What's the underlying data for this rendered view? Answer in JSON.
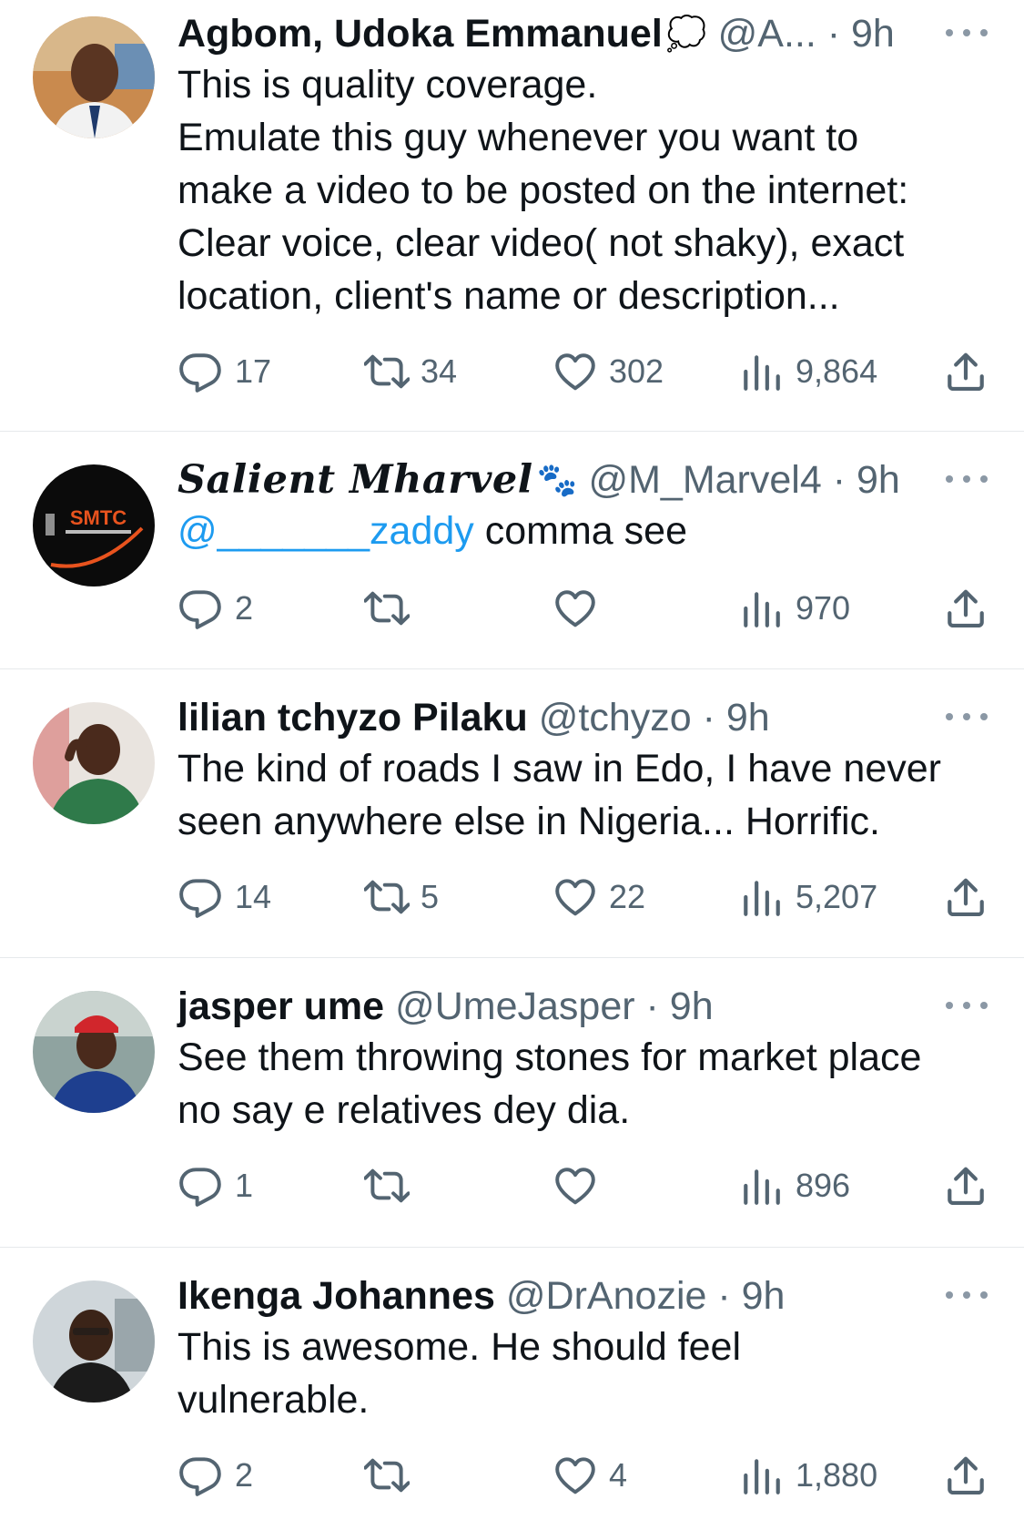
{
  "colors": {
    "text": "#0f1419",
    "secondary": "#536471",
    "link": "#1d9bf0",
    "divider": "#e6e9ec"
  },
  "icons": {
    "reply": "speech-bubble-icon",
    "retweet": "retweet-arrows-icon",
    "like": "heart-icon",
    "views": "bar-chart-icon",
    "share": "share-upload-icon",
    "more": "three-dots-icon"
  },
  "tweets": [
    {
      "name": "Agbom, Udoka Emmanuel",
      "name_emoji": "💭",
      "handle": "@A... · 9h",
      "lines": [
        "This is quality coverage.",
        "Emulate this guy whenever you want to",
        "make a video to be posted on the internet:",
        "Clear voice, clear video( not shaky), exact",
        "location, client's name or description..."
      ],
      "replies": "17",
      "retweets": "34",
      "likes": "302",
      "views": "9,864"
    },
    {
      "name": "Salient Mharvel",
      "name_emoji": "🐾",
      "handle": "@M_Marvel4 · 9h",
      "mention": "@_______zaddy",
      "text_after_mention": " comma see",
      "avatar_text": "SMTC",
      "replies": "2",
      "retweets": "",
      "likes": "",
      "views": "970"
    },
    {
      "name": "lilian tchyzo Pilaku",
      "handle": "@tchyzo · 9h",
      "lines": [
        "The kind of roads I saw in Edo, I have never",
        "seen anywhere else in Nigeria... Horrific."
      ],
      "replies": "14",
      "retweets": "5",
      "likes": "22",
      "views": "5,207"
    },
    {
      "name": "jasper ume",
      "handle": "@UmeJasper · 9h",
      "lines": [
        "See them throwing stones for market place",
        "no say e relatives dey dia."
      ],
      "replies": "1",
      "retweets": "",
      "likes": "",
      "views": "896"
    },
    {
      "name": "Ikenga Johannes",
      "handle": "@DrAnozie · 9h",
      "lines": [
        "This is awesome. He should feel",
        "vulnerable."
      ],
      "replies": "2",
      "retweets": "",
      "likes": "4",
      "views": "1,880"
    }
  ]
}
